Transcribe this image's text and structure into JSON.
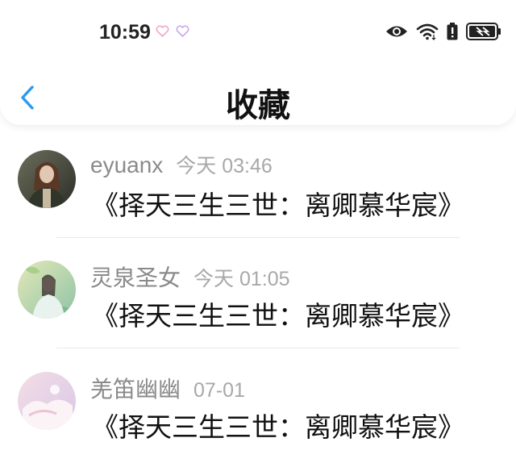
{
  "status_bar": {
    "time": "10:59",
    "icons": [
      "heart-outline-icon",
      "heart-outline-icon",
      "eye-icon",
      "wifi-icon",
      "battery-alert-icon",
      "battery-charging-icon"
    ]
  },
  "header": {
    "back_icon": "chevron-left-icon",
    "title": "收藏"
  },
  "items": [
    {
      "name": "eyuanx",
      "time": "今天 03:46",
      "book": "《择天三生三世：离卿慕华宸》"
    },
    {
      "name": "灵泉圣女",
      "time": "今天 01:05",
      "book": "《择天三生三世：离卿慕华宸》"
    },
    {
      "name": "羌笛幽幽",
      "time": "07-01",
      "book": "《择天三生三世：离卿慕华宸》"
    }
  ],
  "colors": {
    "accent": "#2a9bf0",
    "name_gray": "#8a8a8a",
    "time_gray": "#a8a8a8"
  }
}
